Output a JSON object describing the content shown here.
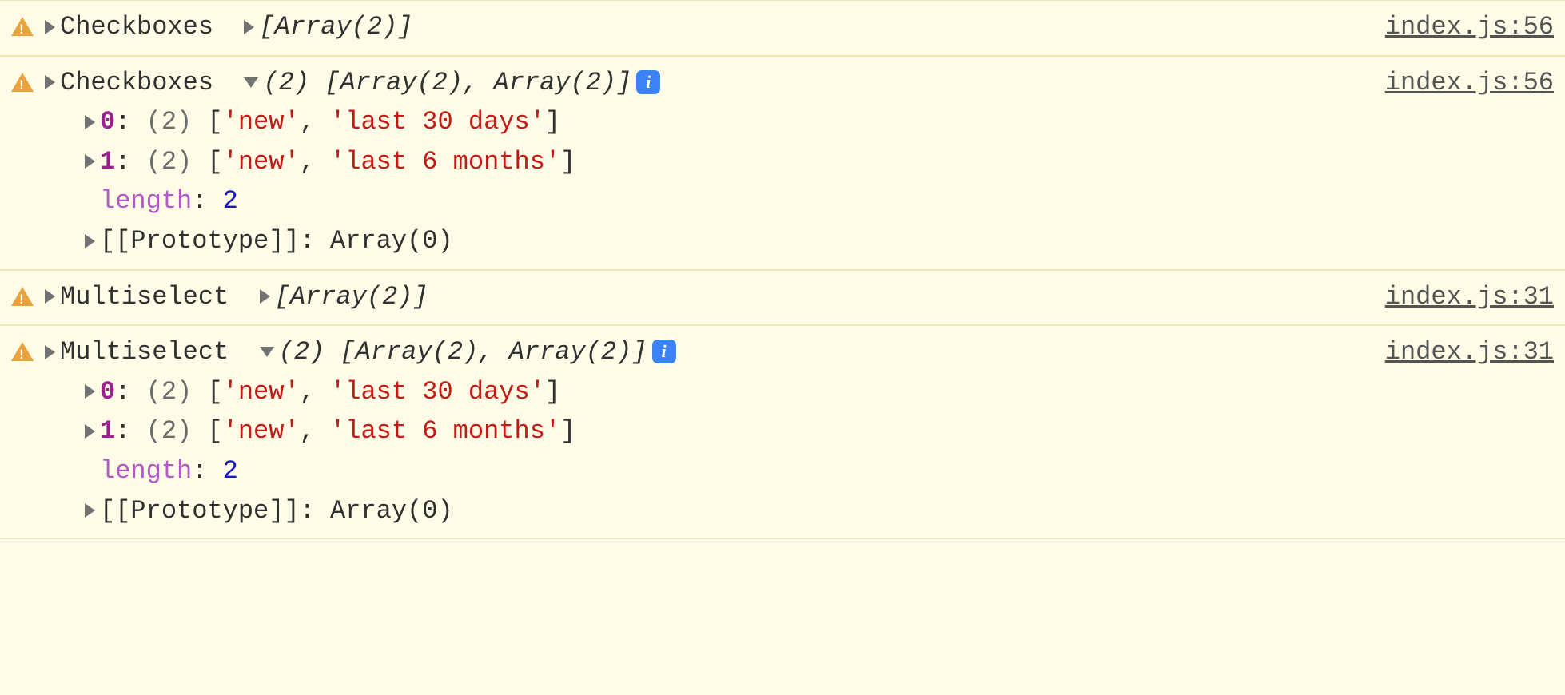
{
  "entries": [
    {
      "label": "Checkboxes",
      "expanded": false,
      "summary_collapsed": "[Array(2)]",
      "source": "index.js:56"
    },
    {
      "label": "Checkboxes",
      "expanded": true,
      "summary_count": "(2)",
      "summary_body": "[Array(2), Array(2)]",
      "source": "index.js:56",
      "children": [
        {
          "type": "elem",
          "index": "0",
          "count": "(2)",
          "open": "[",
          "a": "'new'",
          "sep": ", ",
          "b": "'last 30 days'",
          "close": "]"
        },
        {
          "type": "elem",
          "index": "1",
          "count": "(2)",
          "open": "[",
          "a": "'new'",
          "sep": ", ",
          "b": "'last 6 months'",
          "close": "]"
        },
        {
          "type": "length",
          "key": "length",
          "val": "2"
        },
        {
          "type": "proto",
          "key": "[[Prototype]]",
          "val": "Array(0)"
        }
      ]
    },
    {
      "label": "Multiselect",
      "expanded": false,
      "summary_collapsed": "[Array(2)]",
      "source": "index.js:31"
    },
    {
      "label": "Multiselect",
      "expanded": true,
      "summary_count": "(2)",
      "summary_body": "[Array(2), Array(2)]",
      "source": "index.js:31",
      "children": [
        {
          "type": "elem",
          "index": "0",
          "count": "(2)",
          "open": "[",
          "a": "'new'",
          "sep": ", ",
          "b": "'last 30 days'",
          "close": "]"
        },
        {
          "type": "elem",
          "index": "1",
          "count": "(2)",
          "open": "[",
          "a": "'new'",
          "sep": ", ",
          "b": "'last 6 months'",
          "close": "]"
        },
        {
          "type": "length",
          "key": "length",
          "val": "2"
        },
        {
          "type": "proto",
          "key": "[[Prototype]]",
          "val": "Array(0)"
        }
      ]
    }
  ],
  "info_badge": "i"
}
